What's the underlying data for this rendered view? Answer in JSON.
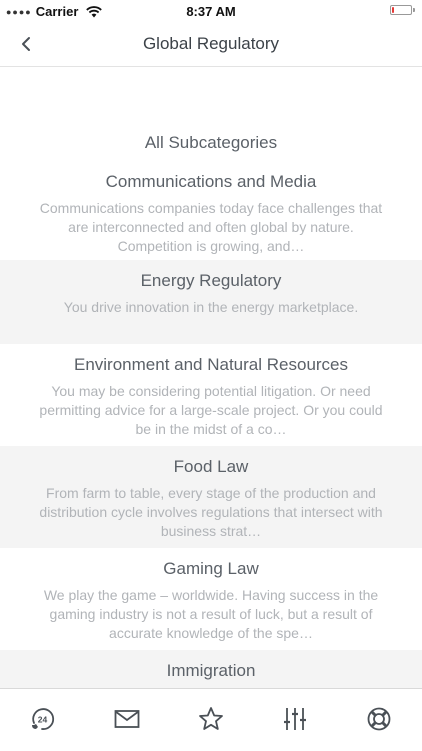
{
  "status_bar": {
    "carrier": "Carrier",
    "time": "8:37 AM",
    "battery_level": 0.1
  },
  "nav": {
    "title": "Global Regulatory",
    "back_icon": "chevron-left-icon"
  },
  "list": {
    "header": "All Subcategories",
    "sections": [
      {
        "title": "Communications and Media",
        "description": "Communications companies today face challenges that are interconnected and often global by nature. Competition is growing, and…"
      },
      {
        "title": "Energy Regulatory",
        "description": "You drive innovation in the energy marketplace."
      },
      {
        "title": "Environment and Natural Resources",
        "description": "You may be considering potential litigation. Or need permitting advice for a large-scale project. Or you could be in the midst of a co…"
      },
      {
        "title": "Food Law",
        "description": "From farm to table, every stage of the production and distribution cycle involves regulations that intersect with business strat…"
      },
      {
        "title": "Gaming Law",
        "description": "We play the game – worldwide. Having success in the gaming industry is not a result of luck, but a result of accurate knowledge of the spe…"
      },
      {
        "title": "Immigration",
        "description": ""
      }
    ]
  },
  "tab_bar": {
    "tabs": [
      {
        "icon": "phone-24-icon",
        "badge": "24"
      },
      {
        "icon": "mail-icon"
      },
      {
        "icon": "star-icon"
      },
      {
        "icon": "sliders-icon"
      },
      {
        "icon": "lifebuoy-icon"
      }
    ]
  },
  "colors": {
    "text": "#5b6168",
    "muted": "#b1b4b8",
    "alt_row": "#f4f4f4",
    "battery": "#e53935"
  }
}
